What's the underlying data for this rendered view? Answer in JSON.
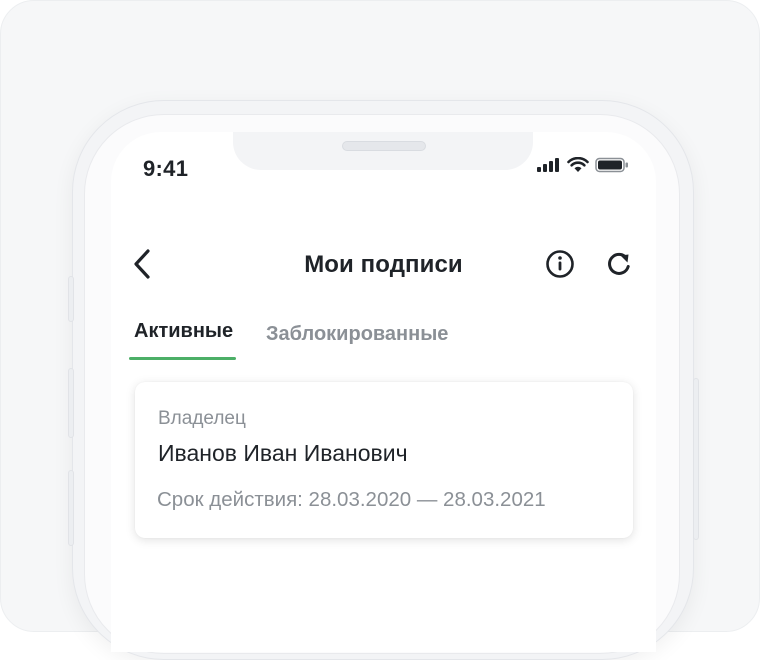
{
  "status_bar": {
    "time": "9:41",
    "icons": [
      "signal-icon",
      "wifi-icon",
      "battery-icon"
    ]
  },
  "nav": {
    "back_icon": "chevron-left-icon",
    "title": "Мои подписи",
    "info_icon": "info-circle-icon",
    "refresh_icon": "refresh-icon"
  },
  "tabs": [
    {
      "label": "Активные",
      "active": true
    },
    {
      "label": "Заблокированные",
      "active": false
    }
  ],
  "card": {
    "owner_label": "Владелец",
    "owner_name": "Иванов Иван Иванович",
    "validity": "Срок действия: 28.03.2020 — 28.03.2021"
  },
  "colors": {
    "accent": "#4caf67",
    "text_primary": "#1f2328",
    "text_secondary": "#8b9096"
  }
}
